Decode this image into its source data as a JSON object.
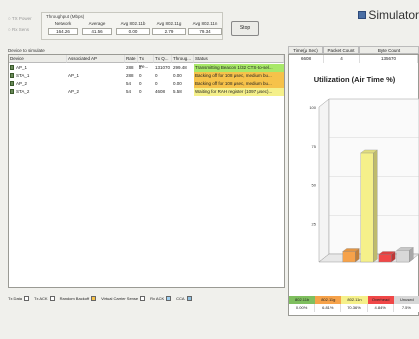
{
  "radios": [
    "TX Power",
    "Rx Sens"
  ],
  "throughput": {
    "title": "Throughput (Mbps)",
    "headers": [
      "Network",
      "Average",
      "Avg 802.11b",
      "Avg 802.11g",
      "Avg 802.11n"
    ],
    "values": [
      "164.26",
      "41.56",
      "0.00",
      "2.79",
      "79.34"
    ]
  },
  "stop_label": "Stop",
  "logo_text": "Simulator",
  "devices_label": "Device to simulate",
  "table": {
    "headers": [
      "Device",
      "Associated AP",
      "Rate",
      "Tx Pe...",
      "Tx Q...",
      "Throug...",
      "Status"
    ],
    "rows": [
      {
        "device": "AP_1",
        "ap": "",
        "rate": "288",
        "txpe": "2",
        "txq": "131070",
        "thr": "299.48",
        "status": "Transmitting Beacon 1/32 CTS-to-sel..."
      },
      {
        "device": "STA_1",
        "ap": "AP_1",
        "rate": "288",
        "txpe": "0",
        "txq": "0",
        "thr": "0.00",
        "status": "Backing off for 108 μsec, medium bu..."
      },
      {
        "device": "AP_2",
        "ap": "",
        "rate": "54",
        "txpe": "0",
        "txq": "0",
        "thr": "0.00",
        "status": "Backing off for 108 μsec, medium bu..."
      },
      {
        "device": "STA_2",
        "ap": "AP_2",
        "rate": "54",
        "txpe": "0",
        "txq": "4608",
        "thr": "5.58",
        "status": "Waiting for RAH register (1097 μsec)..."
      }
    ]
  },
  "stats": {
    "headers": [
      "Time(μ Sec)",
      "Packet Count",
      "Byte Count"
    ],
    "values": [
      "6608",
      "4",
      "135670"
    ]
  },
  "chart_data": {
    "type": "bar",
    "title": "Utilization (Air Time %)",
    "categories": [
      "802.11b",
      "802.11g",
      "802.11n",
      "Overhead",
      "Unused"
    ],
    "values": [
      0.0,
      6.8,
      70.36,
      4.84,
      7.5
    ],
    "ylim": [
      0,
      100
    ],
    "yticks": [
      "100",
      "75",
      "50",
      "25"
    ],
    "value_labels": [
      "0.00%",
      "6.81%",
      "70.36%",
      "4.84%",
      "7.5%"
    ],
    "colors": [
      "#7fbf5f",
      "#f6a24a",
      "#f5f08a",
      "#f04848",
      "#d8d8d8"
    ]
  },
  "bottom_legend": [
    {
      "label": "Tx Data",
      "color": "#ffffff"
    },
    {
      "label": "Tx ACK",
      "color": "#ffffff"
    },
    {
      "label": "Random Backoff",
      "color": "#f6c24a"
    },
    {
      "label": "Virtual Carrier Sense",
      "color": "#ffffff"
    },
    {
      "label": "Rx ACK",
      "color": "#9fd0f0"
    },
    {
      "label": "CCA",
      "color": "#8fc0e0"
    }
  ]
}
